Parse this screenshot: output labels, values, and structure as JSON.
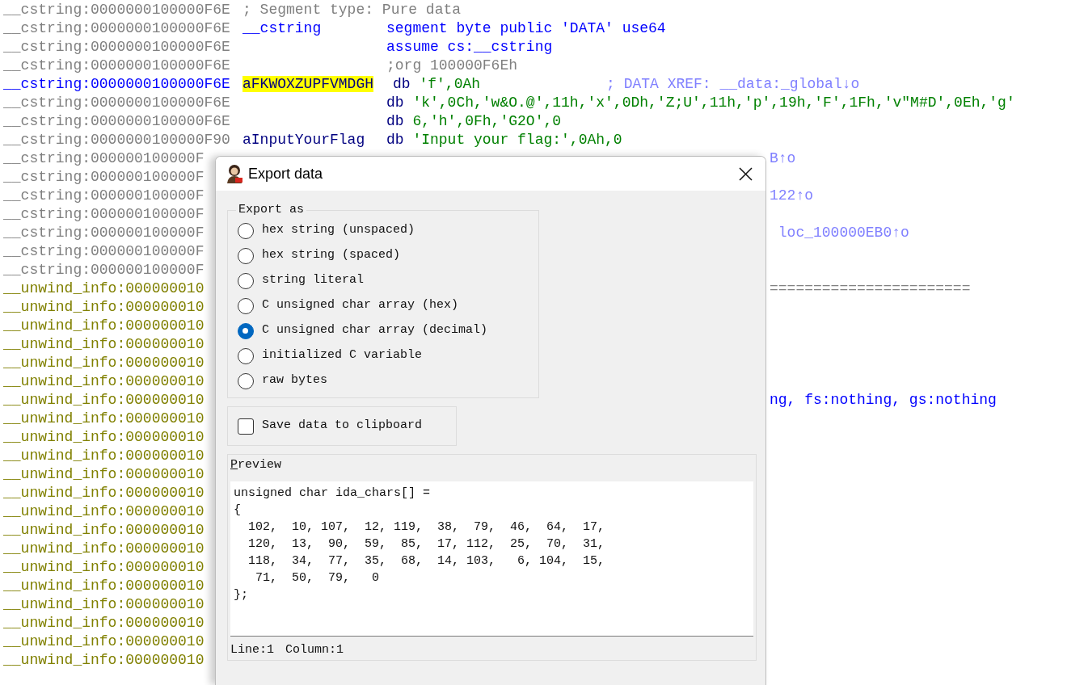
{
  "listing": [
    {
      "address": {
        "text": "__cstring:0000000100000F6E",
        "kind": "plain"
      },
      "label": {
        "text": "; Segment type: Pure data",
        "kind": "comment"
      }
    },
    {
      "address": {
        "text": "__cstring:0000000100000F6E",
        "kind": "plain"
      },
      "label": {
        "text": "__cstring",
        "kind": "segment"
      },
      "code": [
        {
          "text": "segment byte public 'DATA' use64",
          "kind": "keyword"
        }
      ]
    },
    {
      "address": {
        "text": "__cstring:0000000100000F6E",
        "kind": "plain"
      },
      "code": [
        {
          "text": "assume cs:__cstring",
          "kind": "keyword"
        }
      ]
    },
    {
      "address": {
        "text": "__cstring:0000000100000F6E",
        "kind": "plain"
      },
      "code": [
        {
          "text": ";org 100000F6Eh",
          "kind": "comment"
        }
      ]
    },
    {
      "address": {
        "text": "__cstring:0000000100000F6E",
        "kind": "current"
      },
      "label": {
        "text": "aFKWOXZUPFVMDGH",
        "kind": "highlight"
      },
      "code": [
        {
          "text": "db ",
          "kind": "directive"
        },
        {
          "text": "'f',0Ah",
          "kind": "string"
        }
      ],
      "comment": "; DATA XREF: __data:_global↓o"
    },
    {
      "address": {
        "text": "__cstring:0000000100000F6E",
        "kind": "plain"
      },
      "code": [
        {
          "text": "db ",
          "kind": "directive"
        },
        {
          "text": "'k',0Ch,'w&O.@',11h,'x',0Dh,'Z;U',11h,'p',19h,'F',1Fh,'v\"M#D',0Eh,'g'",
          "kind": "string"
        }
      ]
    },
    {
      "address": {
        "text": "__cstring:0000000100000F6E",
        "kind": "plain"
      },
      "code": [
        {
          "text": "db ",
          "kind": "directive"
        },
        {
          "text": "6,'h',0Fh,'G2O',0",
          "kind": "string"
        }
      ]
    },
    {
      "address": {
        "text": "__cstring:0000000100000F90",
        "kind": "plain"
      },
      "label": {
        "text": "aInputYourFlag",
        "kind": "name"
      },
      "code": [
        {
          "text": "db ",
          "kind": "directive"
        },
        {
          "text": "'Input your flag:',0Ah,0",
          "kind": "string"
        }
      ]
    },
    {
      "address": {
        "text": "__cstring:000000100000F",
        "kind": "plain"
      },
      "fragment": {
        "text": "B↑o",
        "kind": "xref"
      }
    },
    {
      "address": {
        "text": "__cstring:000000100000F",
        "kind": "plain"
      }
    },
    {
      "address": {
        "text": "__cstring:000000100000F",
        "kind": "plain"
      },
      "fragment": {
        "text": "122↑o",
        "kind": "xref"
      }
    },
    {
      "address": {
        "text": "__cstring:000000100000F",
        "kind": "plain"
      }
    },
    {
      "address": {
        "text": "__cstring:000000100000F",
        "kind": "plain"
      },
      "fragment": {
        "text": " loc_100000EB0↑o",
        "kind": "xref"
      }
    },
    {
      "address": {
        "text": "__cstring:000000100000F",
        "kind": "plain"
      }
    },
    {
      "address": {
        "text": "__cstring:000000100000F",
        "kind": "plain"
      }
    },
    {
      "address": {
        "text": "__unwind_info:000000010",
        "kind": "unwind"
      },
      "fragment": {
        "text": "=======================",
        "kind": "comment"
      }
    },
    {
      "address": {
        "text": "__unwind_info:000000010",
        "kind": "unwind"
      }
    },
    {
      "address": {
        "text": "__unwind_info:000000010",
        "kind": "unwind"
      }
    },
    {
      "address": {
        "text": "__unwind_info:000000010",
        "kind": "unwind"
      }
    },
    {
      "address": {
        "text": "__unwind_info:000000010",
        "kind": "unwind"
      }
    },
    {
      "address": {
        "text": "__unwind_info:000000010",
        "kind": "unwind"
      }
    },
    {
      "address": {
        "text": "__unwind_info:000000010",
        "kind": "unwind"
      },
      "fragment": {
        "text": "ng, fs:nothing, gs:nothing",
        "kind": "keyword"
      }
    },
    {
      "address": {
        "text": "__unwind_info:000000010",
        "kind": "unwind"
      }
    },
    {
      "address": {
        "text": "__unwind_info:000000010",
        "kind": "unwind"
      }
    },
    {
      "address": {
        "text": "__unwind_info:000000010",
        "kind": "unwind"
      }
    },
    {
      "address": {
        "text": "__unwind_info:000000010",
        "kind": "unwind"
      }
    },
    {
      "address": {
        "text": "__unwind_info:000000010",
        "kind": "unwind"
      }
    },
    {
      "address": {
        "text": "__unwind_info:000000010",
        "kind": "unwind"
      }
    },
    {
      "address": {
        "text": "__unwind_info:000000010",
        "kind": "unwind"
      }
    },
    {
      "address": {
        "text": "__unwind_info:000000010",
        "kind": "unwind"
      }
    },
    {
      "address": {
        "text": "__unwind_info:000000010",
        "kind": "unwind"
      }
    },
    {
      "address": {
        "text": "__unwind_info:000000010",
        "kind": "unwind"
      }
    },
    {
      "address": {
        "text": "__unwind_info:000000010",
        "kind": "unwind"
      }
    },
    {
      "address": {
        "text": "__unwind_info:000000010",
        "kind": "unwind"
      }
    },
    {
      "address": {
        "text": "__unwind_info:000000010",
        "kind": "unwind"
      }
    },
    {
      "address": {
        "text": "__unwind_info:000000010",
        "kind": "unwind"
      }
    }
  ],
  "dialog": {
    "title": "Export data",
    "export_as": {
      "label": "Export as",
      "options": [
        {
          "label": "hex string (unspaced)",
          "selected": false
        },
        {
          "label": "hex string (spaced)",
          "selected": false
        },
        {
          "label": "string literal",
          "selected": false
        },
        {
          "label": "C unsigned char array (hex)",
          "selected": false
        },
        {
          "label": "C unsigned char array (decimal)",
          "selected": true
        },
        {
          "label": "initialized C variable",
          "selected": false
        },
        {
          "label": "raw bytes",
          "selected": false
        }
      ]
    },
    "clipboard": {
      "label": "Save data to clipboard",
      "checked": false
    },
    "preview": {
      "label": "Preview",
      "lines": [
        "unsigned char ida_chars[] =",
        "{",
        "  102,  10, 107,  12, 119,  38,  79,  46,  64,  17,",
        "  120,  13,  90,  59,  85,  17, 112,  25,  70,  31,",
        "  118,  34,  77,  35,  68,  14, 103,   6, 104,  15,",
        "   71,  50,  79,   0",
        "};"
      ],
      "line": "Line:1",
      "column": "Column:1"
    }
  }
}
